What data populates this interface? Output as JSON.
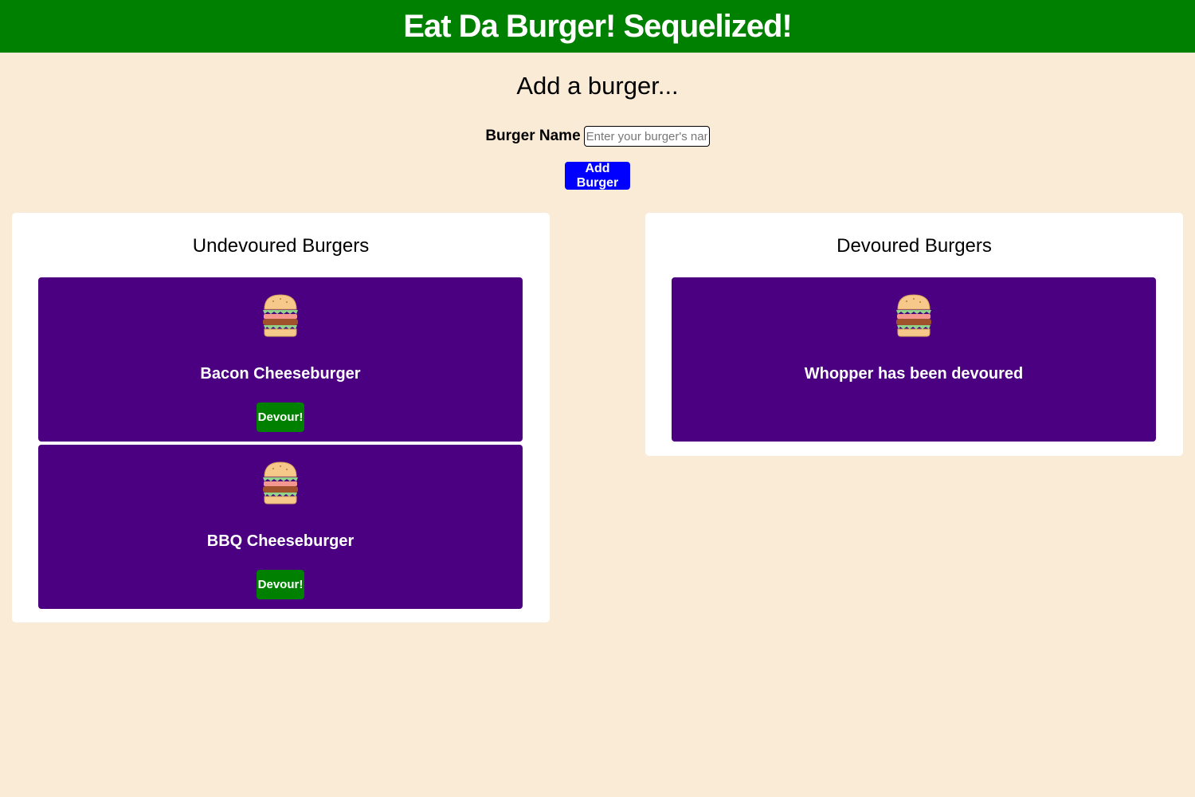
{
  "header": {
    "title": "Eat Da Burger! Sequelized!"
  },
  "add_form": {
    "title": "Add a burger...",
    "label": "Burger Name",
    "placeholder": "Enter your burger's name",
    "value": "",
    "button": "Add Burger"
  },
  "undevoured": {
    "title": "Undevoured Burgers",
    "items": [
      {
        "name": "Bacon Cheeseburger",
        "button": "Devour!"
      },
      {
        "name": "BBQ Cheeseburger",
        "button": "Devour!"
      }
    ]
  },
  "devoured": {
    "title": "Devoured Burgers",
    "items": [
      {
        "name": "Whopper has been devoured"
      }
    ]
  },
  "colors": {
    "header_bg": "#008000",
    "page_bg": "#faebd7",
    "card_bg": "#4b0082",
    "add_button": "#0000ff",
    "devour_button": "#008000"
  },
  "icons": {
    "burger": "burger-icon"
  }
}
